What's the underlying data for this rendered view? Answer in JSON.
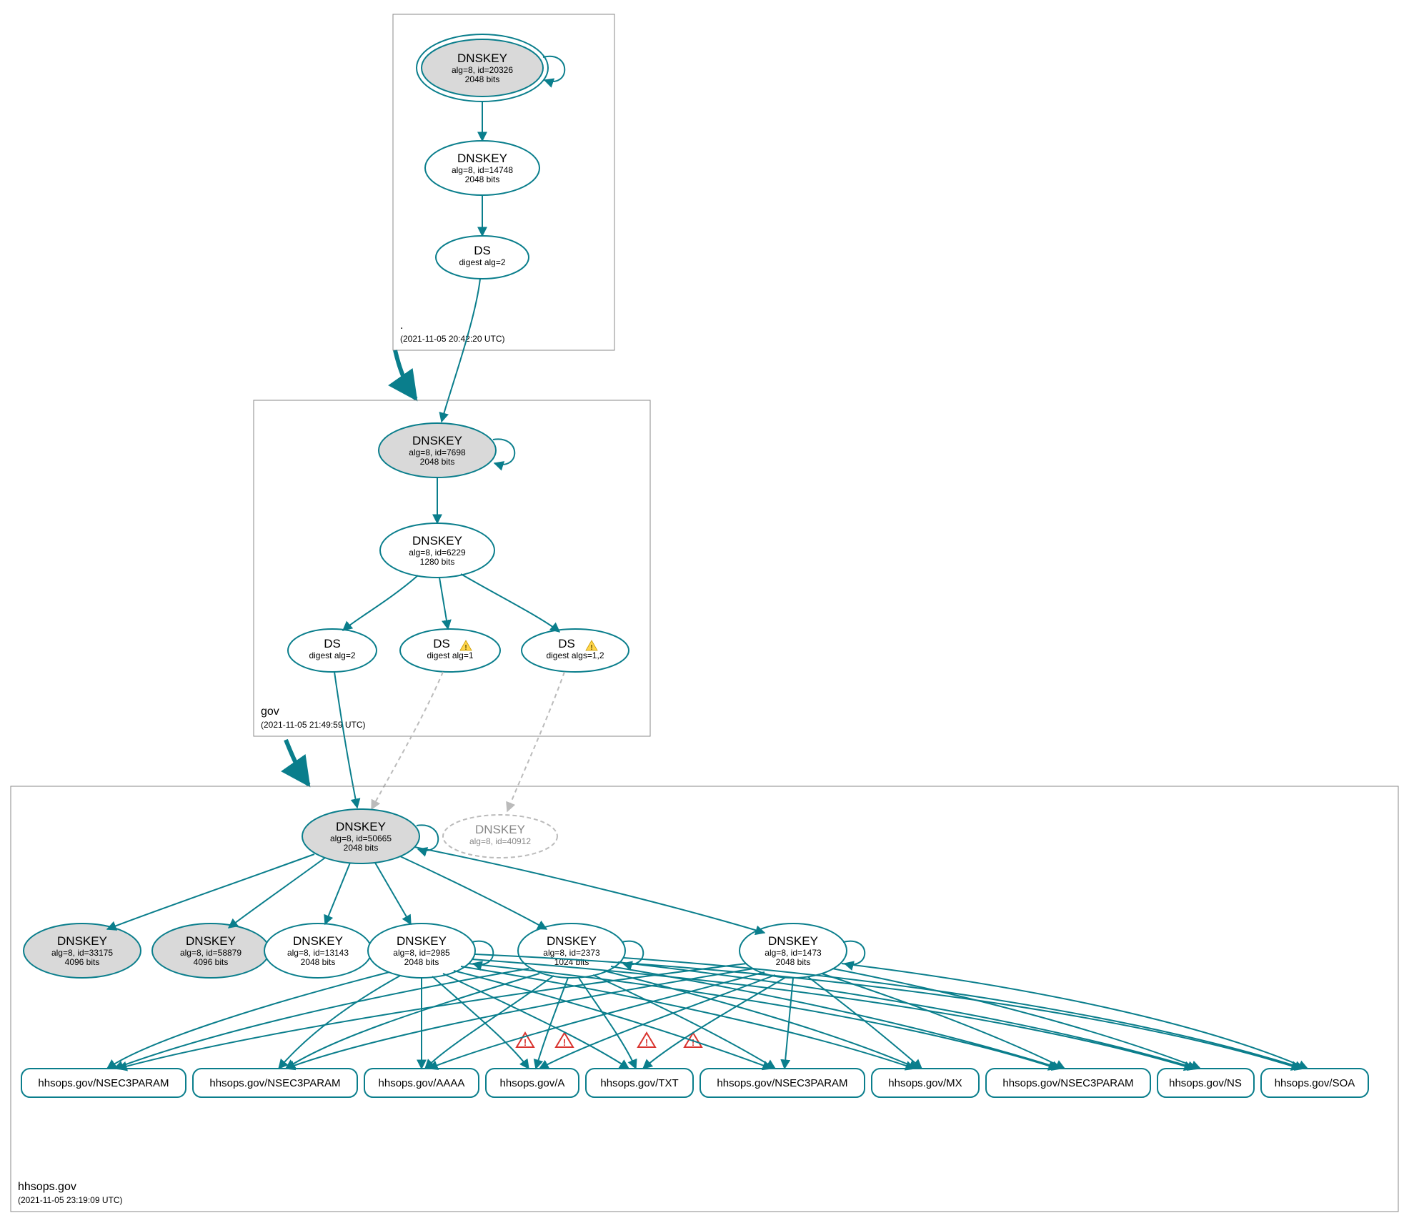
{
  "zones": {
    "root": {
      "label": ".",
      "timestamp": "(2021-11-05 20:42:20 UTC)"
    },
    "gov": {
      "label": "gov",
      "timestamp": "(2021-11-05 21:49:59 UTC)"
    },
    "hhsops": {
      "label": "hhsops.gov",
      "timestamp": "(2021-11-05 23:19:09 UTC)"
    }
  },
  "nodes": {
    "root_ksk": {
      "title": "DNSKEY",
      "sub1": "alg=8, id=20326",
      "sub2": "2048 bits"
    },
    "root_zsk": {
      "title": "DNSKEY",
      "sub1": "alg=8, id=14748",
      "sub2": "2048 bits"
    },
    "root_ds": {
      "title": "DS",
      "sub1": "digest alg=2"
    },
    "gov_ksk": {
      "title": "DNSKEY",
      "sub1": "alg=8, id=7698",
      "sub2": "2048 bits"
    },
    "gov_zsk": {
      "title": "DNSKEY",
      "sub1": "alg=8, id=6229",
      "sub2": "1280 bits"
    },
    "gov_ds1": {
      "title": "DS",
      "sub1": "digest alg=2"
    },
    "gov_ds2": {
      "title": "DS",
      "sub1": "digest alg=1"
    },
    "gov_ds3": {
      "title": "DS",
      "sub1": "digest algs=1,2"
    },
    "hh_ksk": {
      "title": "DNSKEY",
      "sub1": "alg=8, id=50665",
      "sub2": "2048 bits"
    },
    "hh_ghost": {
      "title": "DNSKEY",
      "sub1": "alg=8, id=40912"
    },
    "hh_k1": {
      "title": "DNSKEY",
      "sub1": "alg=8, id=33175",
      "sub2": "4096 bits"
    },
    "hh_k2": {
      "title": "DNSKEY",
      "sub1": "alg=8, id=58879",
      "sub2": "4096 bits"
    },
    "hh_k3": {
      "title": "DNSKEY",
      "sub1": "alg=8, id=13143",
      "sub2": "2048 bits"
    },
    "hh_k4": {
      "title": "DNSKEY",
      "sub1": "alg=8, id=2985",
      "sub2": "2048 bits"
    },
    "hh_k5": {
      "title": "DNSKEY",
      "sub1": "alg=8, id=2373",
      "sub2": "1024 bits"
    },
    "hh_k6": {
      "title": "DNSKEY",
      "sub1": "alg=8, id=1473",
      "sub2": "2048 bits"
    }
  },
  "rrsets": {
    "r1": "hhsops.gov/NSEC3PARAM",
    "r2": "hhsops.gov/NSEC3PARAM",
    "r3": "hhsops.gov/AAAA",
    "r4": "hhsops.gov/A",
    "r5": "hhsops.gov/TXT",
    "r6": "hhsops.gov/NSEC3PARAM",
    "r7": "hhsops.gov/MX",
    "r8": "hhsops.gov/NSEC3PARAM",
    "r9": "hhsops.gov/NS",
    "r10": "hhsops.gov/SOA"
  }
}
